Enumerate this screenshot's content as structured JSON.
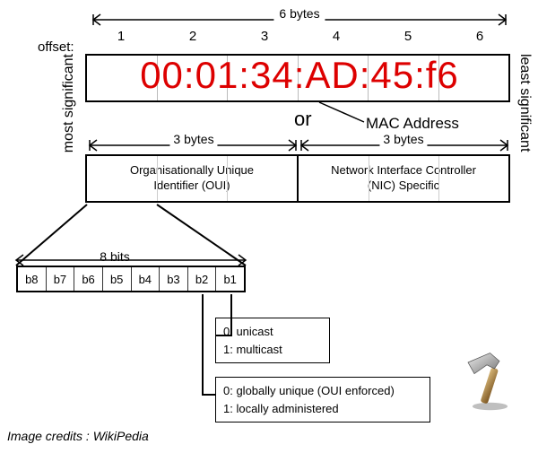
{
  "top": {
    "offset_label": "offset:",
    "six_bytes": "6 bytes",
    "offsets": [
      "1",
      "2",
      "3",
      "4",
      "5",
      "6"
    ]
  },
  "mac": {
    "octets": [
      "00",
      "01",
      "34",
      "AD",
      "45",
      "f6"
    ],
    "sep": ":",
    "pointer_label": "MAC Address",
    "or_label": "or"
  },
  "side": {
    "left": "most significant",
    "right": "least significant"
  },
  "halves": {
    "left_dim": "3 bytes",
    "right_dim": "3 bytes",
    "oui_line1": "Organisationally Unique",
    "oui_line2": "Identifier (OUI)",
    "nic_line1": "Network Interface Controller",
    "nic_line2": "(NIC) Specific"
  },
  "bits": {
    "dim": "8 bits",
    "labels": [
      "b8",
      "b7",
      "b6",
      "b5",
      "b4",
      "b3",
      "b2",
      "b1"
    ]
  },
  "b1": {
    "zero": "0: unicast",
    "one": "1: multicast"
  },
  "b2": {
    "zero": "0: globally unique (OUI enforced)",
    "one": "1: locally administered"
  },
  "credits": "Image credits : WikiPedia",
  "icon": "hammer-icon"
}
